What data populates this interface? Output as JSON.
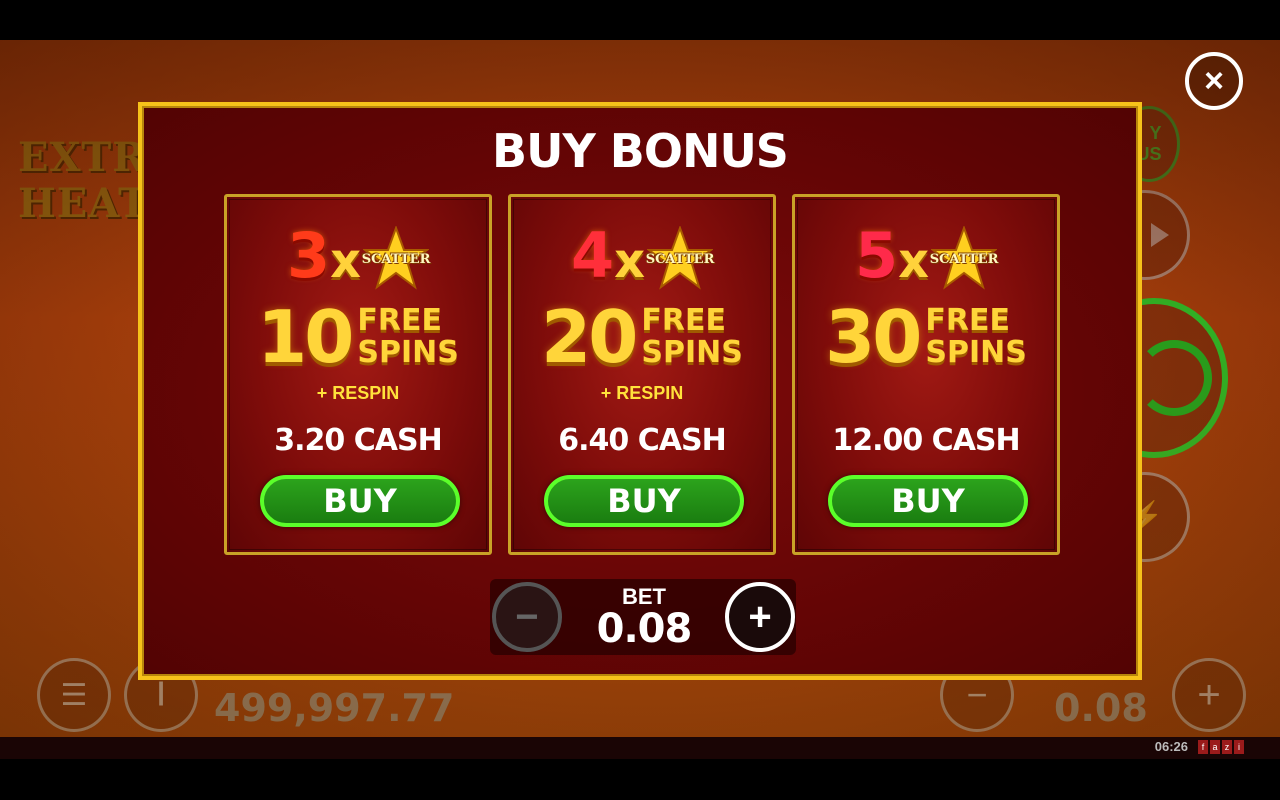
{
  "background": {
    "logo_line1": "EXTR",
    "logo_line2": "HEAT",
    "side_badge": "Y\nUS",
    "balance": "499,997.77",
    "bottom_bet": "0.08",
    "clock": "06:26",
    "brand": [
      "f",
      "a",
      "z",
      "i"
    ]
  },
  "modal": {
    "title": "BUY BONUS",
    "scatter_label": "SCATTER",
    "offers": [
      {
        "multiplier": "3",
        "x_label": "x",
        "spins": "10",
        "free_label": "FREE",
        "spins_label": "SPINS",
        "extra": "+ RESPIN",
        "price": "3.20 CASH",
        "buy_label": "BUY",
        "mult_color": "#ff3b1a"
      },
      {
        "multiplier": "4",
        "x_label": "x",
        "spins": "20",
        "free_label": "FREE",
        "spins_label": "SPINS",
        "extra": "+ RESPIN",
        "price": "6.40 CASH",
        "buy_label": "BUY",
        "mult_color": "#ff2f3a"
      },
      {
        "multiplier": "5",
        "x_label": "x",
        "spins": "30",
        "free_label": "FREE",
        "spins_label": "SPINS",
        "extra": "",
        "price": "12.00 CASH",
        "buy_label": "BUY",
        "mult_color": "#ff2a4a"
      }
    ],
    "bet": {
      "label": "BET",
      "value": "0.08",
      "minus": "−",
      "plus": "+"
    }
  },
  "close_label": "×",
  "colors": {
    "frame": "#f6c21a",
    "buy_border": "#5bff2a",
    "gold": "#ffd53a"
  }
}
